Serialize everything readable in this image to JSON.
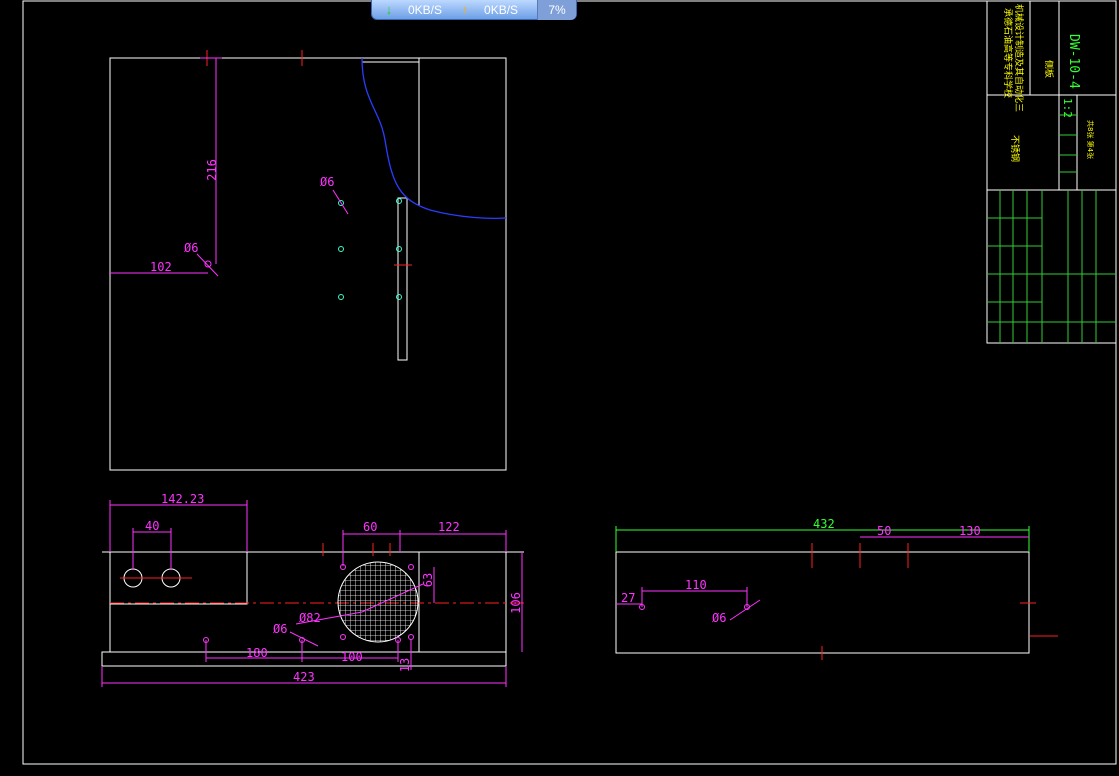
{
  "netmonitor": {
    "download_speed": "0KB/S",
    "upload_speed": "0KB/S",
    "usage": "7%"
  },
  "dimensions": {
    "plan_216": "216",
    "plan_102": "102",
    "plan_hole_a": "Ø6",
    "plan_hole_b": "Ø6",
    "front_14223": "142.23",
    "front_40": "40",
    "front_60": "60",
    "front_122": "122",
    "front_63": "63",
    "front_106": "106",
    "front_82": "Ø82",
    "front_hole": "Ø6",
    "front_180": "180",
    "front_100": "100",
    "front_13": "13",
    "front_423": "423",
    "side_432": "432",
    "side_50": "50",
    "side_130": "130",
    "side_110": "110",
    "side_27": "27",
    "side_hole": "Ø6"
  },
  "title_block": {
    "drawing_number": "DW-10-4",
    "scale": "1:2",
    "material": "不锈钢",
    "part_name": "侧板",
    "school_line1": "承德石油高等专科学校",
    "school_line2": "机械设计制造及其自动化三",
    "sheets": "共8张 第4张"
  },
  "colors": {
    "outline": "#ffffff",
    "dimension": "#ff33ff",
    "dimension_green": "#33ff33",
    "center": "#ff2020",
    "break_line": "#2a3dff",
    "title_text": "#ffff00"
  }
}
